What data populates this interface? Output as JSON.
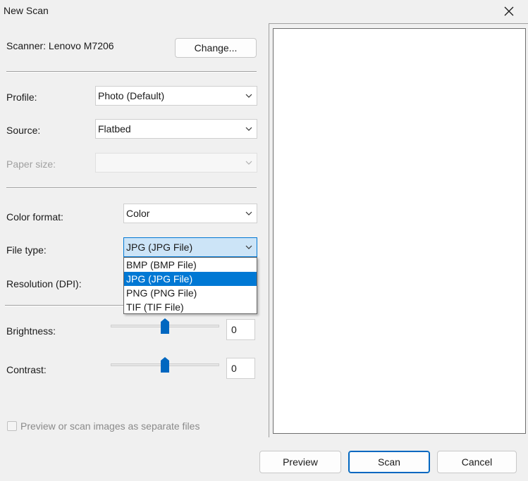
{
  "window": {
    "title": "New Scan"
  },
  "scanner": {
    "label": "Scanner: Lenovo M7206",
    "change_label": "Change..."
  },
  "profile": {
    "label": "Profile:",
    "value": "Photo (Default)"
  },
  "source": {
    "label": "Source:",
    "value": "Flatbed"
  },
  "paper_size": {
    "label": "Paper size:",
    "value": ""
  },
  "color_format": {
    "label": "Color format:",
    "value": "Color"
  },
  "file_type": {
    "label": "File type:",
    "value": "JPG (JPG File)",
    "options": [
      "BMP (BMP File)",
      "JPG (JPG File)",
      "PNG (PNG File)",
      "TIF (TIF File)"
    ],
    "selected_index": 1
  },
  "resolution": {
    "label": "Resolution (DPI):"
  },
  "brightness": {
    "label": "Brightness:",
    "value": "0"
  },
  "contrast": {
    "label": "Contrast:",
    "value": "0"
  },
  "separate_files": {
    "label": "Preview or scan images as separate files",
    "checked": false
  },
  "buttons": {
    "preview": "Preview",
    "scan": "Scan",
    "cancel": "Cancel"
  },
  "colors": {
    "accent": "#0078d4",
    "selected_combo": "#cce4f7"
  },
  "icons": {
    "close": "close-icon",
    "dropdown": "chevron-down-icon"
  }
}
